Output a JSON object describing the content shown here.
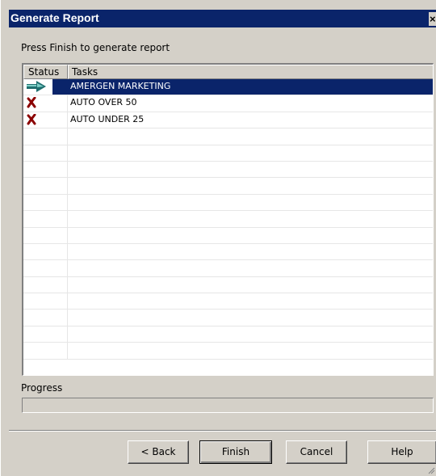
{
  "window": {
    "title": "Generate Report",
    "close_glyph": "×"
  },
  "instruction": "Press Finish to generate report",
  "table": {
    "columns": [
      "Status",
      "Tasks"
    ],
    "rows": [
      {
        "status": "in-progress-arrow-icon",
        "task": "AMERGEN MARKETING",
        "selected": true
      },
      {
        "status": "failed-x-icon",
        "task": "AUTO OVER 50",
        "selected": false
      },
      {
        "status": "failed-x-icon",
        "task": "AUTO UNDER 25",
        "selected": false
      }
    ],
    "empty_rows": 14
  },
  "progress": {
    "label": "Progress",
    "value": 0
  },
  "buttons": {
    "back": "< Back",
    "finish": "Finish",
    "cancel": "Cancel",
    "help": "Help"
  },
  "colors": {
    "titlebar": "#0a246a",
    "selection": "#0a246a",
    "face": "#d4d0c8",
    "failed": "#8b0000",
    "arrow": "#1f6f6f"
  }
}
